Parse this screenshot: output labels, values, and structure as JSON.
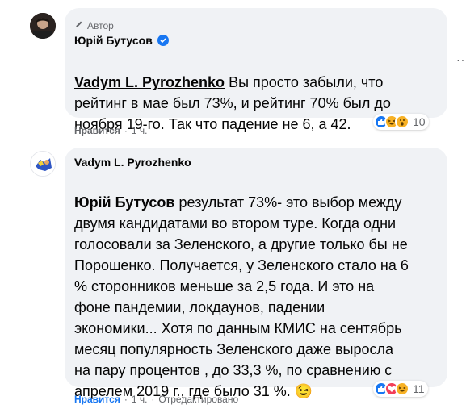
{
  "comment1": {
    "author_tag": "Автор",
    "name": "Юрій Бутусов",
    "mention": "Vadym L. Pyrozhenko",
    "text_lines": [
      " Вы просто забыли, что",
      "рейтинг в мае был 73%, и рейтинг 70% был до",
      "ноября 19-го. Так что падение не 6, а 42."
    ],
    "like_label": "Нравится",
    "time": "1 ч.",
    "reaction_count": "10",
    "reaction_icons": [
      "like-icon",
      "laugh-icon",
      "wow-icon"
    ],
    "more_label": "···"
  },
  "comment2": {
    "name": "Vadym L. Pyrozhenko",
    "mention": "Юрій Бутусов",
    "text_lines": [
      " результат 73%- это выбор между",
      "двумя кандидатами во втором туре. Когда одни",
      "голосовали за Зеленского, а другие только бы не",
      "Порошенко. Получается, у Зеленского стало на 6",
      "% сторонников меньше за 2,5 года. И это на",
      "фоне пандемии, локдаунов, падении",
      "экономики... Хотя по данным КМИС на сентябрь",
      "месяц популярность Зеленского даже выросла",
      "на пару процентов , до 33,3 %, по сравнению с",
      "апрелем 2019 г., где было 31 %. "
    ],
    "emoji": "😉",
    "like_label": "Нравится",
    "time": "1 ч.",
    "edited_label": "Отредактировано",
    "reaction_count": "11",
    "reaction_icons": [
      "like-icon",
      "love-icon",
      "laugh-icon"
    ]
  },
  "colors": {
    "bubble": "#f0f2f5",
    "link_blue": "#1877f2",
    "muted": "#65676b"
  }
}
